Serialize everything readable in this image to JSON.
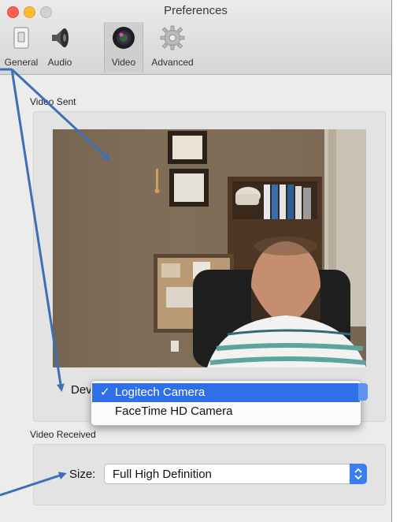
{
  "window": {
    "title": "Preferences"
  },
  "toolbar": {
    "items": [
      {
        "label": "General",
        "icon": "switch-icon"
      },
      {
        "label": "Audio",
        "icon": "speaker-icon"
      },
      {
        "label": "Video",
        "icon": "camera-lens-icon",
        "selected": true
      },
      {
        "label": "Advanced",
        "icon": "gear-icon"
      }
    ]
  },
  "video_sent": {
    "heading": "Video Sent",
    "device_label": "Device",
    "device_options": [
      "Logitech Camera",
      "FaceTime HD Camera"
    ],
    "selected_device": "Logitech Camera",
    "check_glyph": "✓"
  },
  "video_received": {
    "heading": "Video Received",
    "size_label": "Size:",
    "size_value": "Full High Definition"
  },
  "colors": {
    "selection": "#2f6fe8",
    "annotation_arrow": "#3d6fb6"
  }
}
